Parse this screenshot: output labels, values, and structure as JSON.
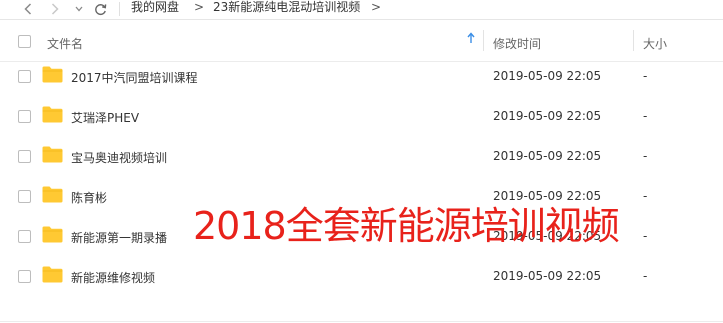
{
  "breadcrumb": {
    "root": "我的网盘",
    "separator": ">",
    "folder": "23新能源纯电混动培训视频"
  },
  "columns": {
    "name": "文件名",
    "modified": "修改时间",
    "size": "大小"
  },
  "files": [
    {
      "name": "2017中汽同盟培训课程",
      "modified": "2019-05-09 22:05",
      "size": "-"
    },
    {
      "name": "艾瑞泽PHEV",
      "modified": "2019-05-09 22:05",
      "size": "-"
    },
    {
      "name": "宝马奥迪视频培训",
      "modified": "2019-05-09 22:05",
      "size": "-"
    },
    {
      "name": "陈育彬",
      "modified": "2019-05-09 22:05",
      "size": "-"
    },
    {
      "name": "新能源第一期录播",
      "modified": "2019-05-09 22:05",
      "size": "-"
    },
    {
      "name": "新能源维修视频",
      "modified": "2019-05-09 22:05",
      "size": "-"
    }
  ],
  "overlay_text": "2018全套新能源培训视频",
  "icons": {
    "back": "chevron-left-icon",
    "forward": "chevron-right-icon",
    "refresh": "refresh-icon",
    "folder": "folder-icon",
    "sort": "sort-ascending-icon"
  },
  "colors": {
    "folder": "#ffc933",
    "sort_accent": "#3a8ee6",
    "overlay": "#e8221b"
  }
}
